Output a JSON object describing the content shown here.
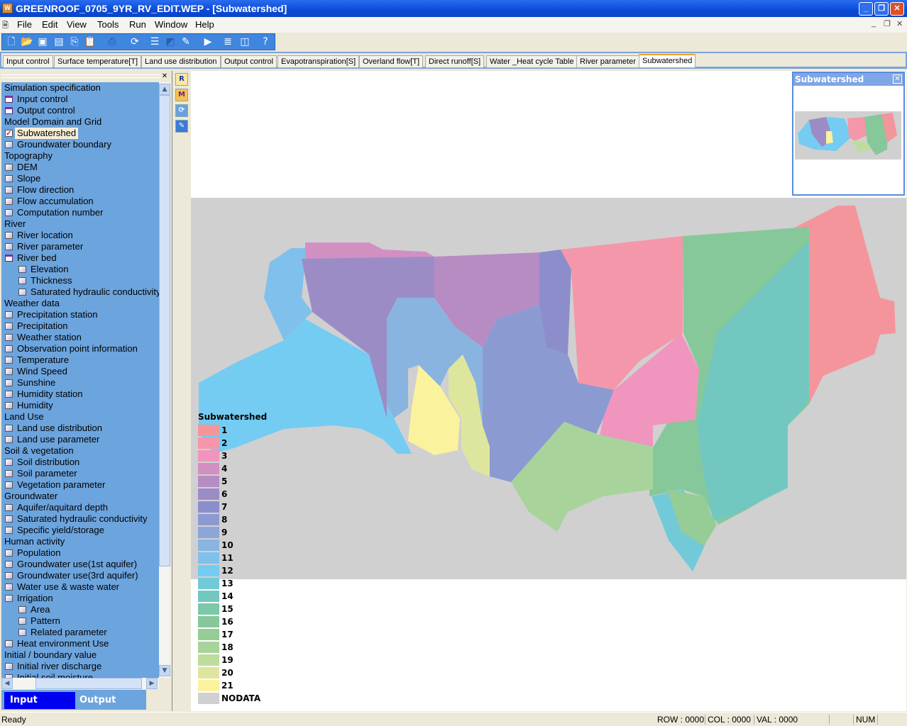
{
  "window": {
    "title": "GREENROOF_0705_9YR_RV_EDIT.WEP - [Subwatershed]",
    "app_icon": "wep-app-icon"
  },
  "menu": [
    "File",
    "Edit",
    "View",
    "Tools",
    "Run",
    "Window",
    "Help"
  ],
  "toolbar": [
    "new-icon",
    "open-icon",
    "save-icon",
    "save-all-icon",
    "copy-icon",
    "paste-icon",
    "print-icon",
    "refresh-icon",
    "list-icon",
    "chart-icon",
    "pencil-icon",
    "run-icon",
    "table-icon",
    "split-icon",
    "help-icon"
  ],
  "tabs": [
    "Input control",
    "Surface temperature[T]",
    "Land use distribution",
    "Output control",
    "Evapotranspiration[S]",
    "Overland flow[T]",
    "Direct runoff[S]",
    "Water _Heat cycle Table",
    "River parameter",
    "Subwatershed"
  ],
  "active_tab": "Subwatershed",
  "sidebar": {
    "items": [
      {
        "label": "Simulation specification",
        "type": "header"
      },
      {
        "label": "Input control",
        "type": "folder"
      },
      {
        "label": "Output control",
        "type": "folder"
      },
      {
        "label": "Model Domain and Grid",
        "type": "header"
      },
      {
        "label": "Subwatershed",
        "type": "checked"
      },
      {
        "label": "Groundwater boundary",
        "type": "check"
      },
      {
        "label": "Topography",
        "type": "header"
      },
      {
        "label": "DEM",
        "type": "check"
      },
      {
        "label": "Slope",
        "type": "check"
      },
      {
        "label": "Flow direction",
        "type": "check"
      },
      {
        "label": "Flow accumulation",
        "type": "check"
      },
      {
        "label": "Computation number",
        "type": "check"
      },
      {
        "label": "River",
        "type": "header"
      },
      {
        "label": "River location",
        "type": "check"
      },
      {
        "label": "River parameter",
        "type": "check"
      },
      {
        "label": "River bed",
        "type": "folder"
      },
      {
        "label": "Elevation",
        "type": "subcheck"
      },
      {
        "label": "Thickness",
        "type": "subcheck"
      },
      {
        "label": "Saturated hydraulic conductivity",
        "type": "subcheck"
      },
      {
        "label": "Weather data",
        "type": "header"
      },
      {
        "label": "Precipitation station",
        "type": "check"
      },
      {
        "label": "Precipitation",
        "type": "check"
      },
      {
        "label": "Weather station",
        "type": "check"
      },
      {
        "label": "Observation point information",
        "type": "check"
      },
      {
        "label": "Temperature",
        "type": "check"
      },
      {
        "label": "Wind Speed",
        "type": "check"
      },
      {
        "label": "Sunshine",
        "type": "check"
      },
      {
        "label": "Humidity station",
        "type": "check"
      },
      {
        "label": "Humidity",
        "type": "check"
      },
      {
        "label": "Land Use",
        "type": "header"
      },
      {
        "label": "Land use distribution",
        "type": "check"
      },
      {
        "label": "Land use parameter",
        "type": "check"
      },
      {
        "label": "Soil & vegetation",
        "type": "header"
      },
      {
        "label": "Soil distribution",
        "type": "check"
      },
      {
        "label": "Soil parameter",
        "type": "check"
      },
      {
        "label": "Vegetation parameter",
        "type": "check"
      },
      {
        "label": "Groundwater",
        "type": "header"
      },
      {
        "label": "Aquifer/aquitard depth",
        "type": "check"
      },
      {
        "label": "Saturated hydraulic conductivity",
        "type": "check"
      },
      {
        "label": "Specific yield/storage",
        "type": "check"
      },
      {
        "label": "Human activity",
        "type": "header"
      },
      {
        "label": "Population",
        "type": "check"
      },
      {
        "label": "Groundwater use(1st aquifer)",
        "type": "check"
      },
      {
        "label": "Groundwater use(3rd aquifer)",
        "type": "check"
      },
      {
        "label": "Water use & waste water",
        "type": "check"
      },
      {
        "label": "Irrigation",
        "type": "check"
      },
      {
        "label": "Area",
        "type": "subcheck"
      },
      {
        "label": "Pattern",
        "type": "subcheck"
      },
      {
        "label": "Related parameter",
        "type": "subcheck"
      },
      {
        "label": "Heat environment Use",
        "type": "check"
      },
      {
        "label": "Initial / boundary value",
        "type": "header"
      },
      {
        "label": "Initial river discharge",
        "type": "check"
      },
      {
        "label": "Initial soil moisture",
        "type": "check"
      }
    ],
    "selected": "Subwatershed",
    "input_label": "Input",
    "output_label": "Output"
  },
  "side_tools": [
    "raster-icon",
    "matrix-icon",
    "rotate-icon",
    "edit-icon"
  ],
  "legend": {
    "title": "Subwatershed",
    "items": [
      {
        "label": "1",
        "color": "#F4959C"
      },
      {
        "label": "2",
        "color": "#F497AA"
      },
      {
        "label": "3",
        "color": "#F096BE"
      },
      {
        "label": "4",
        "color": "#D290C2"
      },
      {
        "label": "5",
        "color": "#B68CC2"
      },
      {
        "label": "6",
        "color": "#9C8CC6"
      },
      {
        "label": "7",
        "color": "#8C8ECC"
      },
      {
        "label": "8",
        "color": "#8C9AD2"
      },
      {
        "label": "9",
        "color": "#8CA6D8"
      },
      {
        "label": "10",
        "color": "#8AB4E0"
      },
      {
        "label": "11",
        "color": "#80C0EC"
      },
      {
        "label": "12",
        "color": "#74CCF2"
      },
      {
        "label": "13",
        "color": "#72CAD8"
      },
      {
        "label": "14",
        "color": "#72C8C0"
      },
      {
        "label": "15",
        "color": "#7CC8AA"
      },
      {
        "label": "16",
        "color": "#86C89A"
      },
      {
        "label": "17",
        "color": "#96CC96"
      },
      {
        "label": "18",
        "color": "#A8D49C"
      },
      {
        "label": "19",
        "color": "#BEDC9C"
      },
      {
        "label": "20",
        "color": "#DEE69E"
      },
      {
        "label": "21",
        "color": "#FBF29E"
      },
      {
        "label": "NODATA",
        "color": "#D0D0D0"
      }
    ]
  },
  "overview": {
    "title": "Subwatershed"
  },
  "status": {
    "ready": "Ready",
    "row": "ROW : 0000",
    "col": "COL : 0000",
    "val": "VAL : 0000",
    "num": "NUM"
  }
}
